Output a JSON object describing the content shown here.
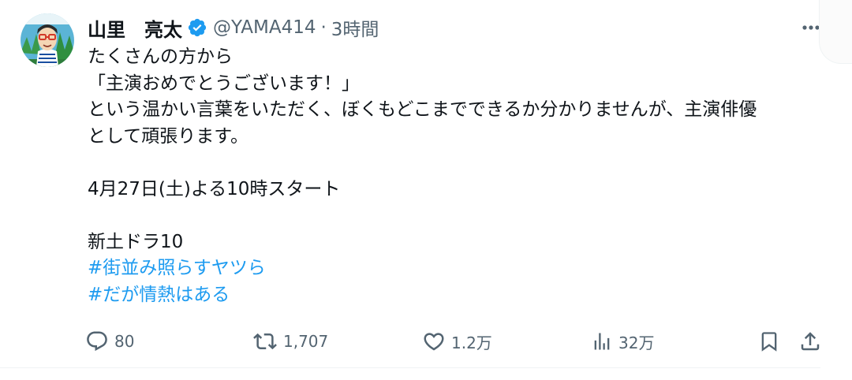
{
  "author": {
    "name": "山里　亮太",
    "handle": "@YAMA414",
    "separator": "·",
    "time": "3時間",
    "verified": true,
    "avatar_icon": "cartoon-avatar"
  },
  "menu_icon": "more-horizontal-icon",
  "tweet": {
    "lines": [
      "たくさんの方から",
      "「主演おめでとうございます！」",
      "という温かい言葉をいただく、ぼくもどこまでできるか分かりませんが、主演俳優",
      "として頑張ります。"
    ],
    "date_line": "4月27日(土)よる10時スタート",
    "program_line": "新土ドラ10",
    "hashtags": [
      "#街並み照らすヤツら",
      "#だが情熱はある"
    ]
  },
  "actions": {
    "reply_count": "80",
    "retweet_count": "1,707",
    "like_count": "1.2万",
    "views_count": "32万"
  },
  "colors": {
    "text": "#0f1419",
    "secondary": "#536471",
    "link": "#1d9bf0",
    "verified": "#1d9bf0"
  }
}
